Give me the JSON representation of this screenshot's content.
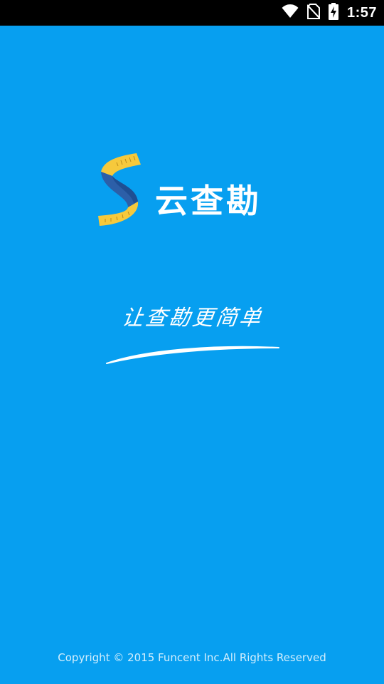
{
  "status_bar": {
    "time": "1:57",
    "icons": [
      "wifi-icon",
      "no-sim-icon",
      "battery-charging-icon"
    ]
  },
  "splash": {
    "logo_icon": "measuring-tape-s-logo-icon",
    "app_name": "云查勘",
    "slogan": "让查勘更简单",
    "copyright": "Copyright © 2015 Funcent Inc.All Rights Reserved"
  },
  "colors": {
    "background": "#079ff0",
    "status_bar": "#000000",
    "tape_yellow": "#f6c93c",
    "tape_blue": "#2c5fa8"
  }
}
